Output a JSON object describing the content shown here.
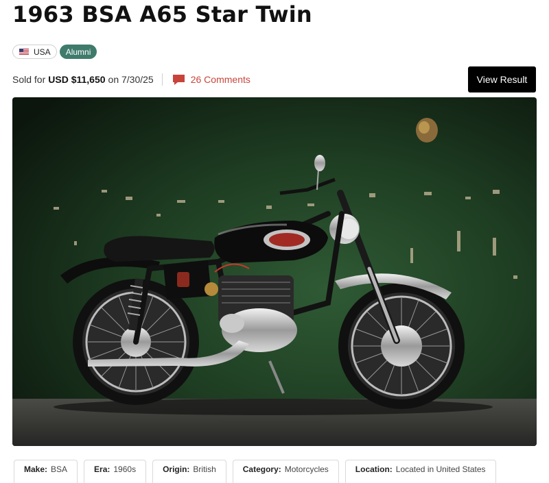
{
  "listing": {
    "title": "1963 BSA A65 Star Twin",
    "country_chip": "USA",
    "country_flag_icon": "us-flag-icon",
    "alumni_chip": "Alumni",
    "sold_prefix": "Sold for",
    "sold_price": "USD $11,650",
    "sold_on": "on 7/30/25",
    "comments_label": "26 Comments",
    "comments_icon": "speech-bubble-icon",
    "view_result_button": "View Result"
  },
  "photo": {
    "alt": "1963 BSA A65 Star Twin motorcycle against green wall"
  },
  "specs": [
    {
      "key": "Make:",
      "value": "BSA"
    },
    {
      "key": "Era:",
      "value": "1960s"
    },
    {
      "key": "Origin:",
      "value": "British"
    },
    {
      "key": "Category:",
      "value": "Motorcycles"
    },
    {
      "key": "Location:",
      "value": "Located in United States"
    }
  ],
  "colors": {
    "alumni_chip": "#3f7b6b",
    "comments_link": "#c8443a",
    "view_button": "#000000"
  }
}
